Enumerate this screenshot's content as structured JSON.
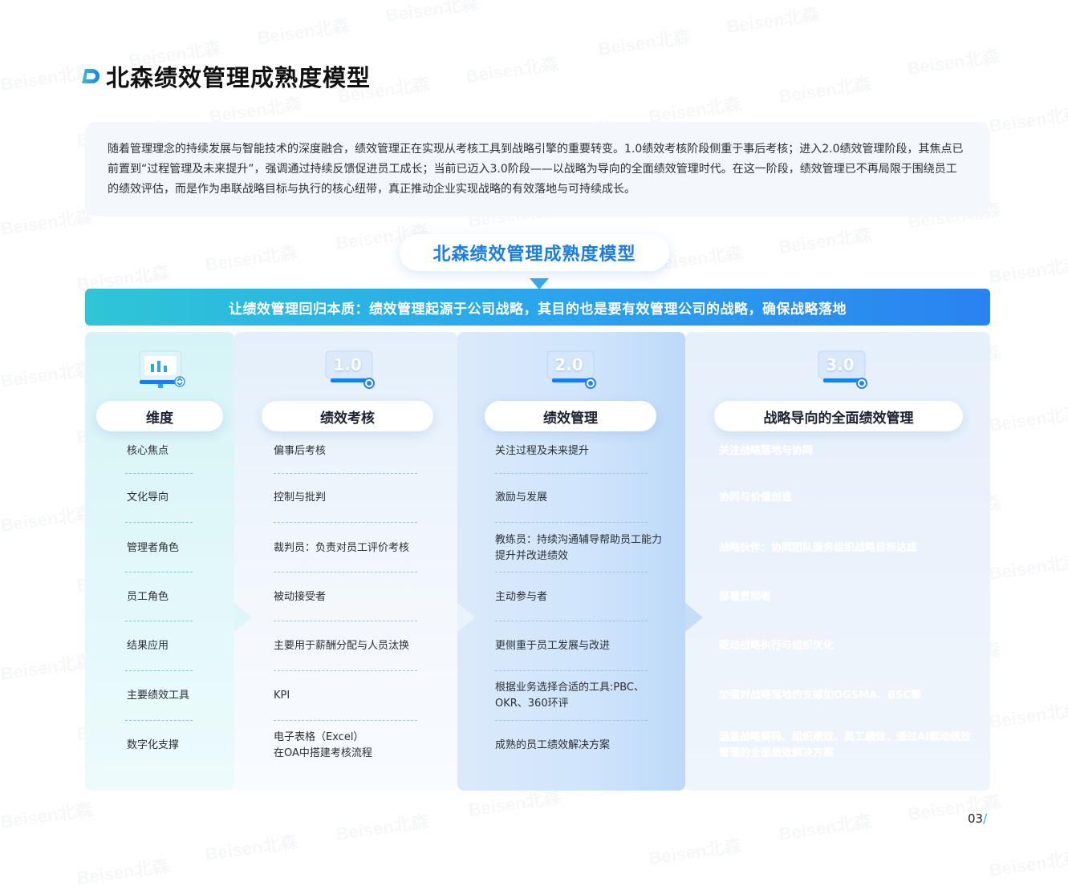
{
  "header": {
    "title": "北森绩效管理成熟度模型"
  },
  "intro": {
    "text": "随着管理理念的持续发展与智能技术的深度融合，绩效管理正在实现从考核工具到战略引擎的重要转变。1.0绩效考核阶段侧重于事后考核；进入2.0绩效管理阶段，其焦点已前置到“过程管理及未来提升”，强调通过持续反馈促进员工成长；当前已迈入3.0阶段——以战略为导向的全面绩效管理时代。在这一阶段，绩效管理已不再局限于围绕员工的绩效评估，而是作为串联战略目标与执行的核心纽带，真正推动企业实现战略的有效落地与可持续成长。"
  },
  "model": {
    "title": "北森绩效管理成熟度模型",
    "banner": "让绩效管理回归本质：绩效管理起源于公司战略，其目的也是要有效管理公司的战略，确保战略落地",
    "columns": [
      {
        "heading": "维度",
        "badge": "",
        "cells": [
          "核心焦点",
          "文化导向",
          "管理者角色",
          "员工角色",
          "结果应用",
          "主要绩效工具",
          "数字化支撑"
        ]
      },
      {
        "heading": "绩效考核",
        "badge": "1.0",
        "cells": [
          "偏事后考核",
          "控制与批判",
          "裁判员：负责对员工评价考核",
          "被动接受者",
          "主要用于薪酬分配与人员汰换",
          "KPI",
          "电子表格（Excel）\n在OA中搭建考核流程"
        ]
      },
      {
        "heading": "绩效管理",
        "badge": "2.0",
        "cells": [
          "关注过程及未来提升",
          "激励与发展",
          "教练员：持续沟通辅导帮助员工能力提升并改进绩效",
          "主动参与者",
          "更侧重于员工发展与改进",
          "根据业务选择合适的工具:PBC、OKR、360环评",
          "成熟的员工绩效解决方案"
        ]
      },
      {
        "heading": "战略导向的全面绩效管理",
        "badge": "3.0",
        "cells": [
          "关注战略落地与协同",
          "协同与价值创造",
          "战略伙伴：协同团队服务组织战略目标达成",
          "部署贯彻者",
          "驱动战略执行与组织优化",
          "加强对战略落地的支撑如OGSMA、BSC等",
          "涵盖战略解码、组织绩效、员工绩效、通过AI驱动绩效管理的全面绩效解决方案"
        ]
      }
    ]
  },
  "watermark": "Beisen北森",
  "footer": {
    "page": "03",
    "slash": "/"
  },
  "colors": {
    "accent": "#1a7ee8",
    "teal": "#2ec6d6",
    "banner_end": "#2a82f0"
  }
}
